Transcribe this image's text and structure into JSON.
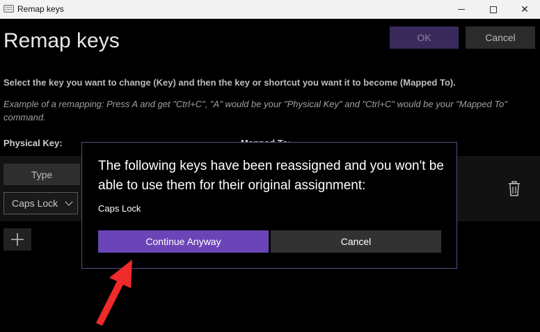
{
  "window": {
    "title": "Remap keys",
    "minimize_icon": "minimize-icon",
    "maximize_icon": "maximize-icon",
    "close_icon": "close-icon",
    "close_glyph": "✕"
  },
  "header": {
    "title": "Remap keys",
    "ok_label": "OK",
    "cancel_label": "Cancel"
  },
  "instructions": {
    "main": "Select the key you want to change (Key) and then the key or shortcut you want it to become (Mapped To).",
    "example": "Example of a remapping: Press A and get \"Ctrl+C\", \"A\" would be your \"Physical Key\" and \"Ctrl+C\" would be your \"Mapped To\" command."
  },
  "columns": {
    "physical": "Physical Key:",
    "mapped": "Mapped To:"
  },
  "row": {
    "type_label": "Type",
    "selected_key": "Caps Lock",
    "delete_icon": "trash-icon"
  },
  "add_icon": "plus-icon",
  "dialog": {
    "message": "The following keys have been reassigned and you won't be able to use them for their original assignment:",
    "keys": "Caps Lock",
    "continue_label": "Continue Anyway",
    "cancel_label": "Cancel"
  },
  "colors": {
    "accent": "#6b45b7",
    "dialog_border": "#5a4e84",
    "arrow": "#ee2a2a"
  }
}
